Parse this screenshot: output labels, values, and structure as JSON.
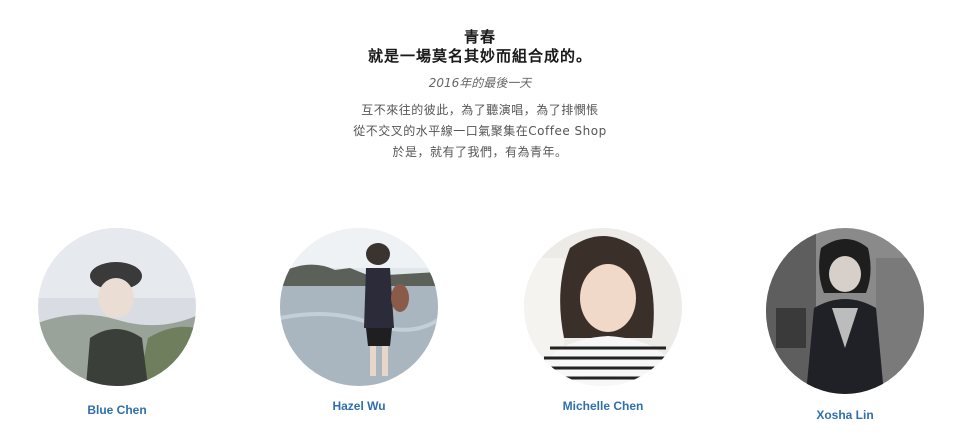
{
  "header": {
    "title_line1": "青春",
    "title_line2": "就是一場莫名其妙而組合成的。",
    "date": "2016年的最後一天",
    "desc_line1": "互不來往的彼此，為了聽演唱，為了排憫悵",
    "desc_line2": "從不交叉的水平線一口氣聚集在Coffee Shop",
    "desc_line3": "於是，就有了我們，有為青年。"
  },
  "members": [
    {
      "name": "Blue Chen",
      "avatar": "avatar-photo"
    },
    {
      "name": "Hazel Wu",
      "avatar": "avatar-photo"
    },
    {
      "name": "Michelle Chen",
      "avatar": "avatar-photo"
    },
    {
      "name": "Xosha Lin",
      "avatar": "avatar-photo"
    }
  ],
  "colors": {
    "name_link": "#2f6fae",
    "title": "#1a1a1a",
    "body_text": "#555555"
  }
}
